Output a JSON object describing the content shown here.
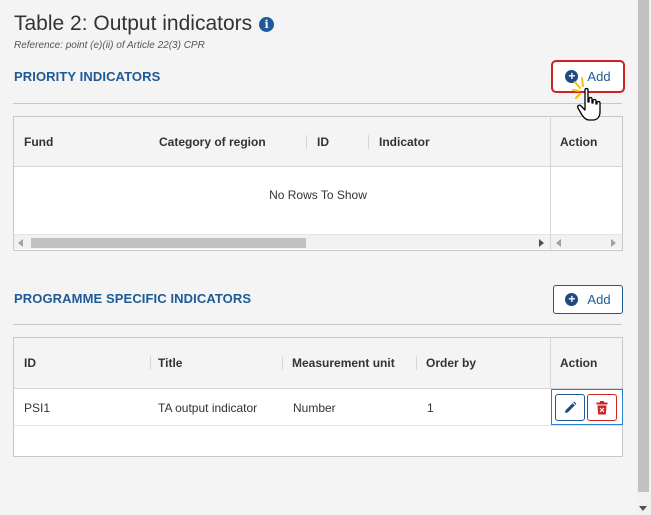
{
  "page": {
    "title": "Table 2: Output indicators",
    "reference": "Reference: point (e)(ii) of Article 22(3) CPR"
  },
  "priority_indicators": {
    "section_title": "PRIORITY INDICATORS",
    "add_label": "Add",
    "columns": [
      "Fund",
      "Category of region",
      "ID",
      "Indicator",
      "Action"
    ],
    "empty_message": "No Rows To Show"
  },
  "programme_specific_indicators": {
    "section_title": "PROGRAMME SPECIFIC INDICATORS",
    "add_label": "Add",
    "columns": [
      "ID",
      "Title",
      "Measurement unit",
      "Order by",
      "Action"
    ],
    "rows": [
      {
        "id": "PSI1",
        "title": "TA output indicator",
        "measurement_unit": "Number",
        "order_by": "1"
      }
    ]
  },
  "colors": {
    "accent": "#1e5a96",
    "delete": "#cc2222",
    "highlight": "#cc2222"
  },
  "icons": {
    "title_info": "info-icon",
    "add": "plus-circle-icon",
    "edit": "pencil-icon",
    "delete": "trash-icon",
    "cursor": "hand-pointer-icon"
  }
}
